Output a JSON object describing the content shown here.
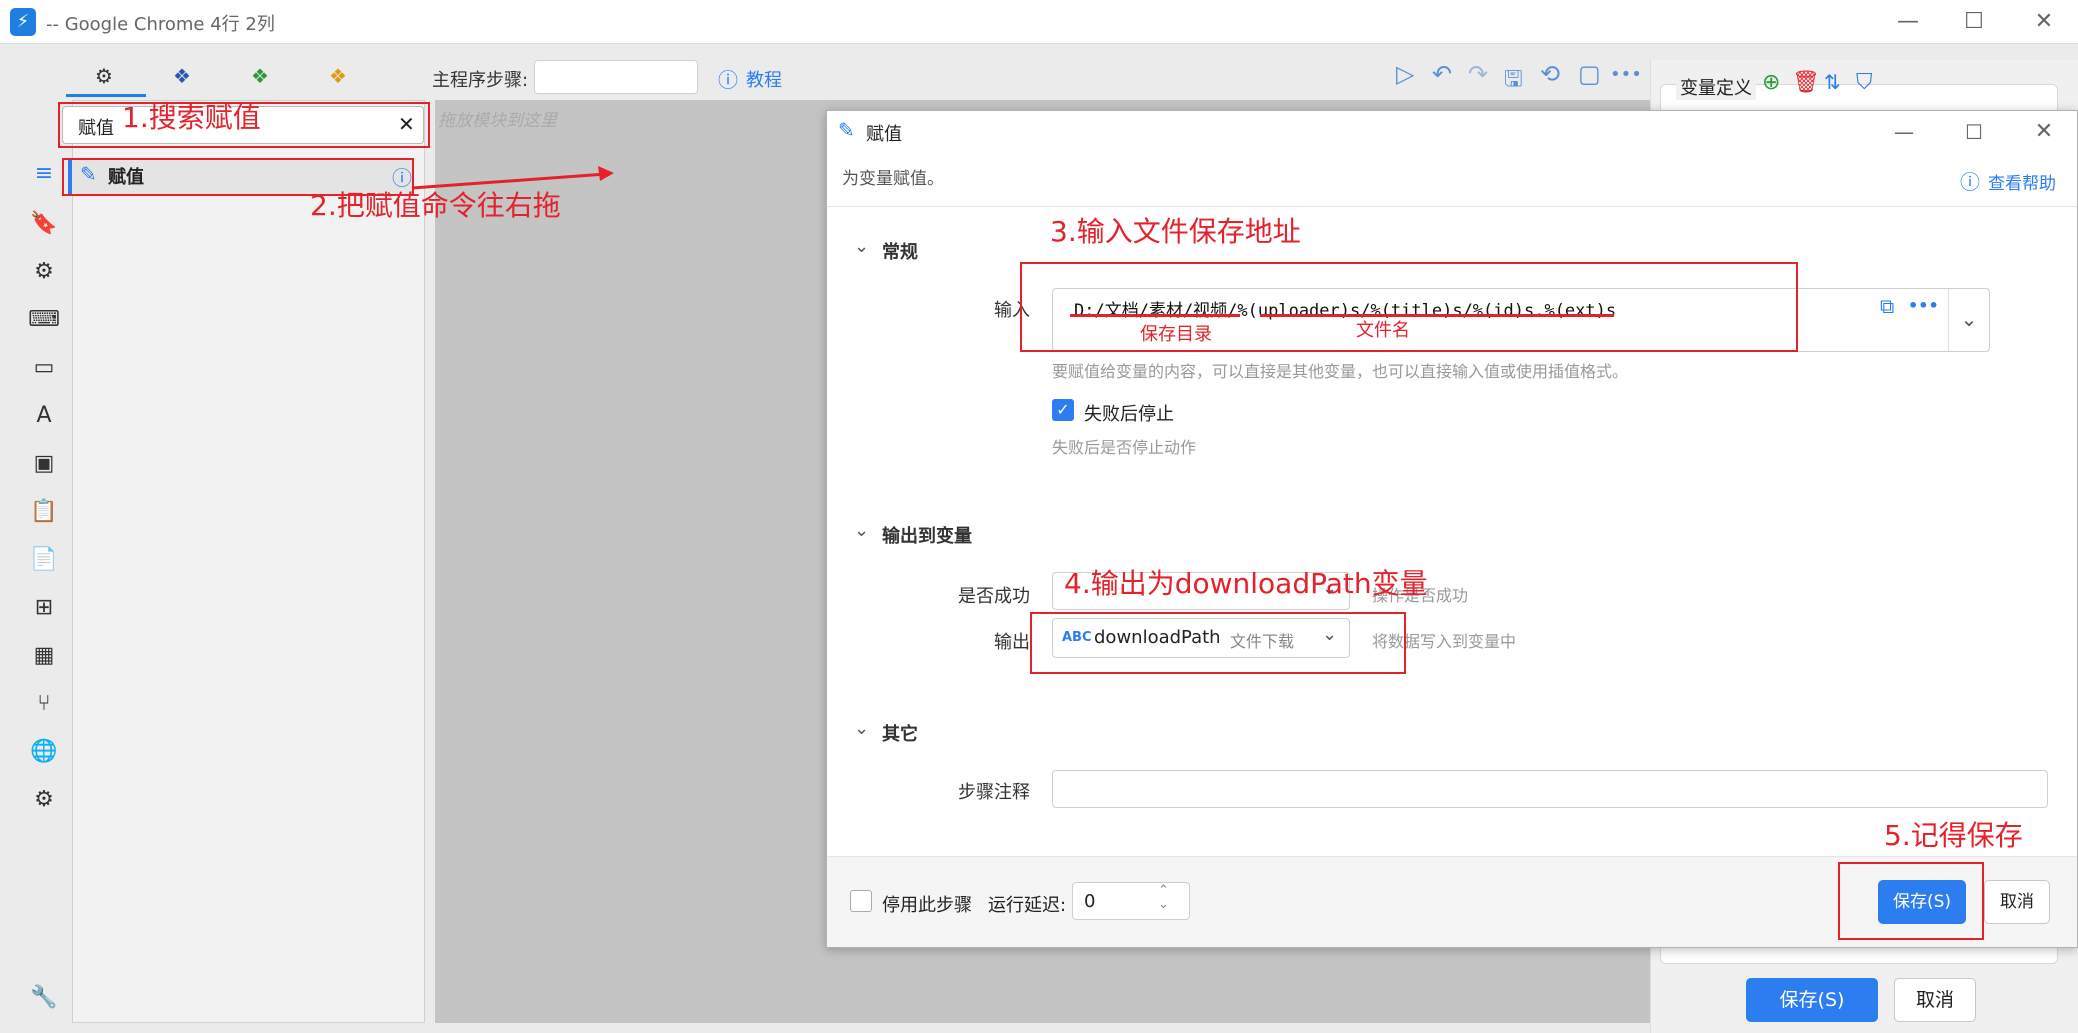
{
  "window": {
    "title": "-- Google Chrome 4行 2列",
    "logo": "⚡"
  },
  "toolbar": {
    "tabs": [
      {
        "icon": "gears-icon",
        "glyph": "⚙",
        "color": "#333333"
      },
      {
        "icon": "blue-cubes-icon",
        "glyph": "❖",
        "color": "#2a56b0"
      },
      {
        "icon": "green-cubes-icon",
        "glyph": "❖",
        "color": "#2a9a3a"
      },
      {
        "icon": "orange-cubes-icon",
        "glyph": "❖",
        "color": "#e09a14"
      }
    ],
    "subprogram_label": "主程序步骤:",
    "subprogram_value": "",
    "tutorial_label": "教程",
    "actions": [
      "▷",
      "↶",
      "↷",
      "🖫",
      "⟲",
      "▢",
      "•••"
    ]
  },
  "left": {
    "search_value": "赋值",
    "result_label": "赋值",
    "rail_icons": [
      "≡",
      "🔖",
      "⚙",
      "⌨",
      "▭",
      "A",
      "▣",
      "📋",
      "📄",
      "⊞",
      "▦",
      "⑂",
      "🌐",
      "⚙",
      "🔧"
    ]
  },
  "canvas": {
    "placeholder": "拖放模块到这里"
  },
  "right_panel": {
    "title": "变量定义",
    "save_button": "保存(S)",
    "cancel_button": "取消"
  },
  "dialog": {
    "title": "赋值",
    "description": "为变量赋值。",
    "help_link": "查看帮助",
    "section_general": "常规",
    "input_label": "输入",
    "input_value": "D:/文档/素材/视频/%(uploader)s/%(title)s/%(id)s.%(ext)s",
    "input_hint": "要赋值给变量的内容，可以直接是其他变量，也可以直接输入值或使用插值格式。",
    "stop_on_fail_label": "失败后停止",
    "stop_on_fail_checked": true,
    "stop_on_fail_hint": "失败后是否停止动作",
    "section_output": "输出到变量",
    "success_label": "是否成功",
    "success_hint": "操作是否成功",
    "output_label": "输出",
    "output_type_badge": "ABC",
    "output_var": "downloadPath",
    "output_var_desc": "文件下载",
    "output_hint": "将数据写入到变量中",
    "section_other": "其它",
    "note_label": "步骤注释",
    "note_value": "",
    "disable_step_label": "停用此步骤",
    "disable_step_checked": false,
    "delay_label": "运行延迟:",
    "delay_value": "0",
    "save_button": "保存(S)",
    "cancel_button": "取消"
  },
  "annotations": {
    "step1": "1.搜索赋值",
    "step2": "2.把赋值命令往右拖",
    "step3": "3.输入文件保存地址",
    "step4": "4.输出为downloadPath变量",
    "step5": "5.记得保存",
    "dir_label": "保存目录",
    "file_label": "文件名",
    "color": "#e5212b"
  }
}
